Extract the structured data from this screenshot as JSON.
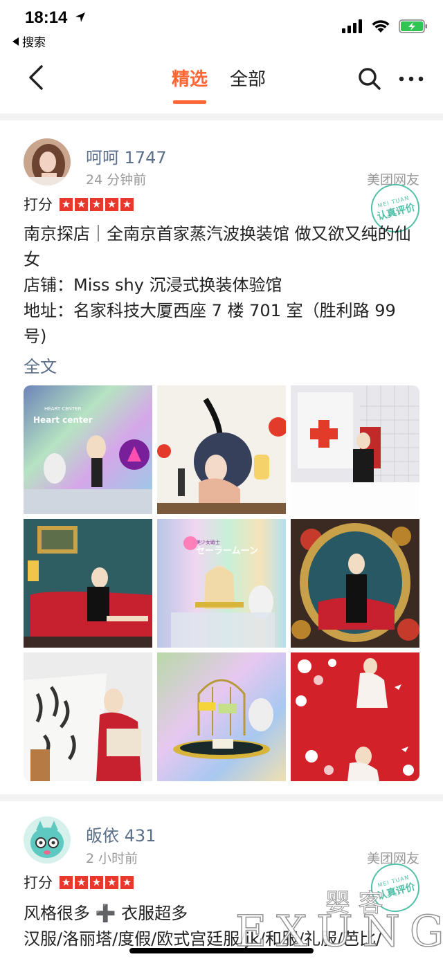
{
  "status_bar": {
    "time": "18:14",
    "back_app": "搜索"
  },
  "nav": {
    "tabs": [
      {
        "label": "精选",
        "active": true
      },
      {
        "label": "全部",
        "active": false
      }
    ]
  },
  "reviews": [
    {
      "user_name": "呵呵 1747",
      "time": "24 分钟前",
      "source": "美团网友",
      "rating_label": "打分",
      "stars": 5,
      "stamp_top": "MEI TUAN",
      "stamp_text": "认真评价",
      "lines": [
        "南京探店｜全南京首家蒸汽波换装馆 做又欲又纯的仙女",
        "店铺：Miss shy 沉浸式换装体验馆",
        "地址：名家科技大厦西座 7 楼 701 室（胜利路 99 号)"
      ],
      "full_text_link": "全文",
      "photo_texts": [
        "Heart center",
        "HEART CENTER",
        "美少女戦士",
        "セーラームーン"
      ]
    },
    {
      "user_name": "皈依 431",
      "time": "2 小时前",
      "source": "美团网友",
      "rating_label": "打分",
      "stars": 5,
      "stamp_top": "MEI TUAN",
      "stamp_text": "认真评价",
      "lines": [
        "风格很多 ➕ 衣服超多",
        "汉服/洛丽塔/度假/欧式宫廷服/jk/和服/礼服/芭比/"
      ]
    }
  ],
  "watermark": {
    "brand": "EXUNG",
    "cn": "婴 客"
  },
  "colors": {
    "accent": "#ff6633",
    "star_red": "#e8382b",
    "username_blue": "#5c6f8a",
    "stamp_green": "#52c0a8"
  }
}
